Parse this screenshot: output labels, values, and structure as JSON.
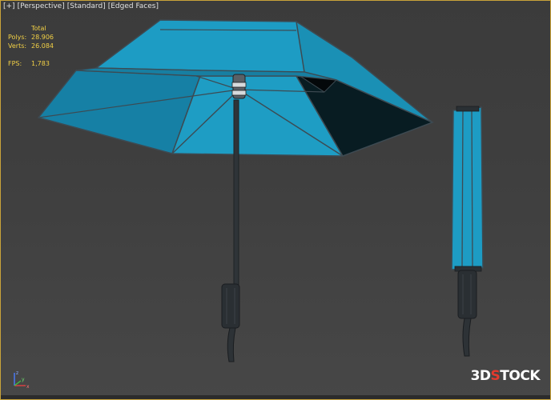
{
  "viewport": {
    "menu": {
      "plus": "[+]",
      "view": "[Perspective]",
      "shading": "[Standard]",
      "edges": "[Edged Faces]"
    },
    "stats": {
      "header": "Total",
      "polys_label": "Polys:",
      "polys_value": "28.906",
      "verts_label": "Verts:",
      "verts_value": "26.084",
      "fps_label": "FPS:",
      "fps_value": "1,783"
    },
    "axis": {
      "x": "x",
      "y": "y",
      "z": "z"
    },
    "watermark": {
      "prefix": "3D",
      "accent": "S",
      "suffix": "TOCK"
    }
  },
  "colors": {
    "canopy": "#1d9cc4",
    "canopy_dark": "#0f6a89",
    "edge": "#3d4a52",
    "stats_text": "#f2d046",
    "border": "#c9a33a",
    "accent_red": "#e33a2e"
  },
  "icons": [
    "axis-gizmo-icon"
  ]
}
